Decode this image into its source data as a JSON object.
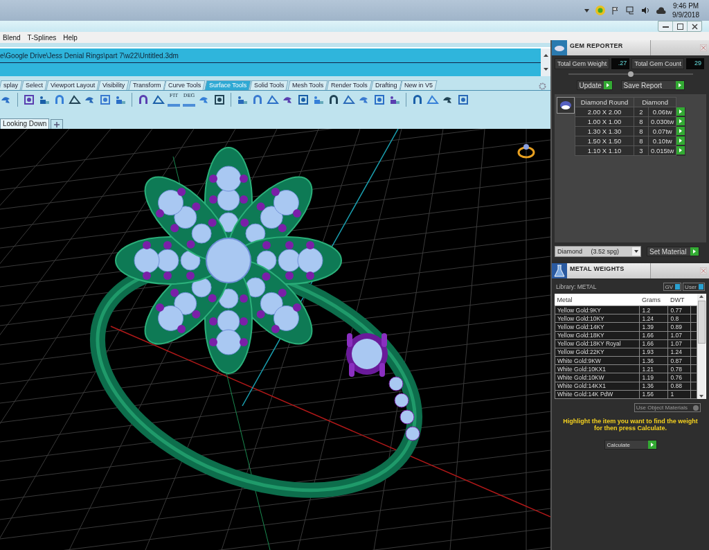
{
  "taskbar": {
    "time": "9:46 PM",
    "date": "9/9/2018"
  },
  "menu": [
    "Blend",
    "T-Splines",
    "Help"
  ],
  "command": {
    "path": "e\\Google Drive\\Jess Denial Rings\\part 7\\w22\\Untitled.3dm"
  },
  "tabs": [
    {
      "label": "splay",
      "selected": false
    },
    {
      "label": "Select",
      "selected": false
    },
    {
      "label": "Viewport Layout",
      "selected": false
    },
    {
      "label": "Visibility",
      "selected": false
    },
    {
      "label": "Transform",
      "selected": false
    },
    {
      "label": "Curve Tools",
      "selected": false
    },
    {
      "label": "Surface Tools",
      "selected": true
    },
    {
      "label": "Solid Tools",
      "selected": false
    },
    {
      "label": "Mesh Tools",
      "selected": false
    },
    {
      "label": "Render Tools",
      "selected": false
    },
    {
      "label": "Drafting",
      "selected": false
    },
    {
      "label": "New in V5",
      "selected": false
    }
  ],
  "toolbar": {
    "labels": [
      "FIT",
      "DEG"
    ]
  },
  "viewport_tabs": [
    {
      "label": "Looking Down",
      "selected": true
    }
  ],
  "gem_reporter": {
    "title": "GEM REPORTER",
    "weight_label": "Total Gem Weight",
    "weight": ".27",
    "count_label": "Total Gem Count",
    "count": "29",
    "update": "Update",
    "save": "Save Report",
    "columns": [
      "Diamond Round",
      "Diamond"
    ],
    "rows": [
      {
        "size": "2.00 X 2.00",
        "count": "2",
        "weight": "0.06tw"
      },
      {
        "size": "1.00 X 1.00",
        "count": "8",
        "weight": "0.030tw"
      },
      {
        "size": "1.30 X 1.30",
        "count": "8",
        "weight": "0.07tw"
      },
      {
        "size": "1.50 X 1.50",
        "count": "8",
        "weight": "0.10tw"
      },
      {
        "size": "1.10 X 1.10",
        "count": "3",
        "weight": "0.015tw"
      }
    ],
    "material": "Diamond     (3.52 spg)",
    "set_material": "Set Material"
  },
  "metal_weights": {
    "title": "METAL WEIGHTS",
    "library": "Library: METAL",
    "toggles": [
      {
        "label": "GV",
        "on": true
      },
      {
        "label": "User",
        "on": true
      }
    ],
    "columns": [
      "Metal",
      "Grams",
      "DWT"
    ],
    "rows": [
      [
        "Yellow Gold:9KY",
        "1.2",
        "0.77"
      ],
      [
        "Yellow Gold:10KY",
        "1.24",
        "0.8"
      ],
      [
        "Yellow Gold:14KY",
        "1.39",
        "0.89"
      ],
      [
        "Yellow Gold:18KY",
        "1.66",
        "1.07"
      ],
      [
        "Yellow Gold:18KY Royal",
        "1.66",
        "1.07"
      ],
      [
        "Yellow Gold:22KY",
        "1.93",
        "1.24"
      ],
      [
        "White Gold:9KW",
        "1.36",
        "0.87"
      ],
      [
        "White Gold:10KX1",
        "1.21",
        "0.78"
      ],
      [
        "White Gold:10KW",
        "1.19",
        "0.76"
      ],
      [
        "White Gold:14KX1",
        "1.36",
        "0.88"
      ],
      [
        "White Gold:14K PdW",
        "1.56",
        "1"
      ]
    ],
    "use_object": {
      "label": "Use Object Materials",
      "checked": false
    },
    "hint": "Highlight the item you want to find the weight for then press Calculate.",
    "calculate": "Calculate"
  }
}
